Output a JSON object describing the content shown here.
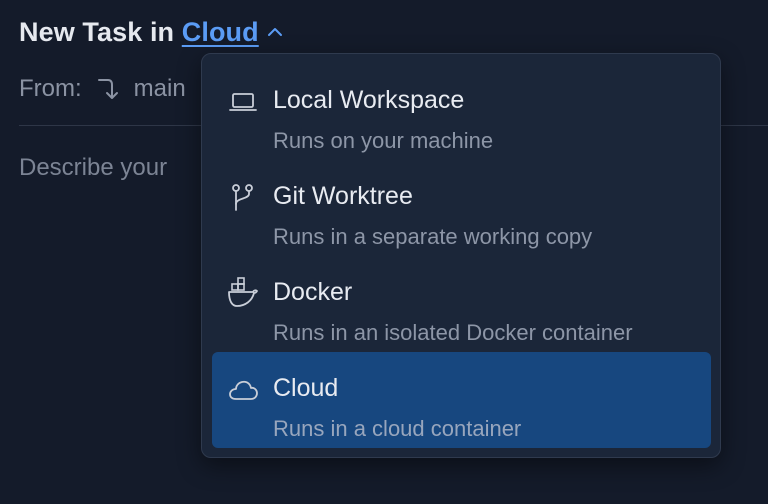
{
  "header": {
    "prefix": "New Task in ",
    "environment": "Cloud"
  },
  "from": {
    "label": "From:",
    "branch": "main"
  },
  "prompt": {
    "placeholder": "Describe your"
  },
  "menu": {
    "items": [
      {
        "title": "Local Workspace",
        "description": "Runs on your machine",
        "icon": "laptop-icon",
        "selected": false
      },
      {
        "title": "Git Worktree",
        "description": "Runs in a separate working copy",
        "icon": "git-branch-icon",
        "selected": false
      },
      {
        "title": "Docker",
        "description": "Runs in an isolated Docker container",
        "icon": "docker-icon",
        "selected": false
      },
      {
        "title": "Cloud",
        "description": "Runs in a cloud container",
        "icon": "cloud-icon",
        "selected": true
      }
    ]
  },
  "colors": {
    "background": "#141b2a",
    "menu_background": "#1b2639",
    "selected_background": "#17477f",
    "link": "#5b9cf5"
  }
}
